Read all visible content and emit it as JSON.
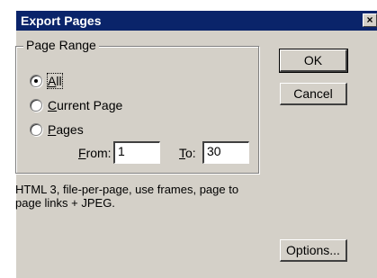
{
  "window": {
    "title": "Export Pages",
    "close_glyph": "×"
  },
  "page_range": {
    "legend": "Page Range",
    "options": [
      {
        "pre": "",
        "key": "A",
        "post": "ll",
        "selected": true
      },
      {
        "pre": "",
        "key": "C",
        "post": "urrent Page",
        "selected": false
      },
      {
        "pre": "",
        "key": "P",
        "post": "ages",
        "selected": false
      }
    ],
    "from_label_key": "F",
    "from_label_rest": "rom:",
    "from_value": "1",
    "to_label_key": "T",
    "to_label_rest": "o:",
    "to_value": "30"
  },
  "description": "HTML 3, file-per-page, use frames, page to page links + JPEG.",
  "buttons": {
    "ok": "OK",
    "cancel": "Cancel",
    "options": "Options..."
  }
}
